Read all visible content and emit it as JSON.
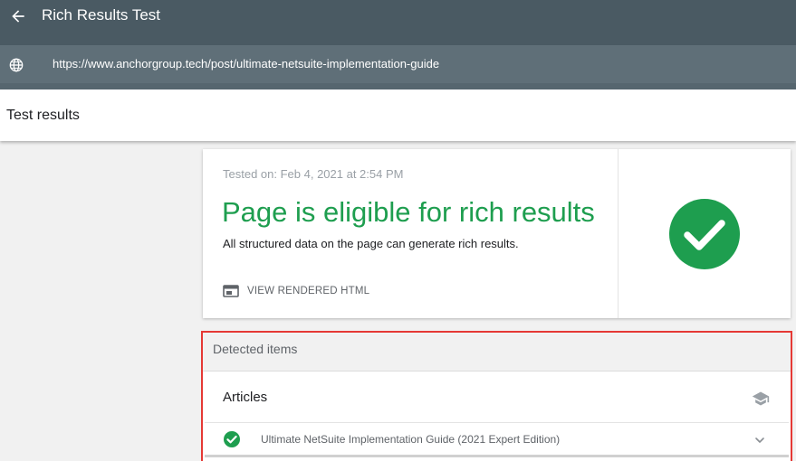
{
  "app": {
    "title": "Rich Results Test"
  },
  "url_bar": {
    "url": "https://www.anchorgroup.tech/post/ultimate-netsuite-implementation-guide"
  },
  "results_header": {
    "title": "Test results"
  },
  "summary_card": {
    "tested_on": "Tested on: Feb 4, 2021 at 2:54 PM",
    "status_title": "Page is eligible for rich results",
    "status_description": "All structured data on the page can generate rich results.",
    "view_rendered_label": "VIEW RENDERED HTML",
    "status_color": "#1e9e4f"
  },
  "detected_items": {
    "header": "Detected items",
    "section_title": "Articles",
    "items": [
      {
        "label": "Ultimate NetSuite Implementation Guide (2021 Expert Edition)",
        "status": "valid"
      }
    ],
    "highlight_color": "#e53935"
  },
  "icons": {
    "back": "arrow-left-icon",
    "globe": "globe-icon",
    "view_html": "browser-window-icon",
    "status": "check-circle-icon",
    "section": "graduation-cap-icon",
    "expand": "chevron-down-icon"
  }
}
